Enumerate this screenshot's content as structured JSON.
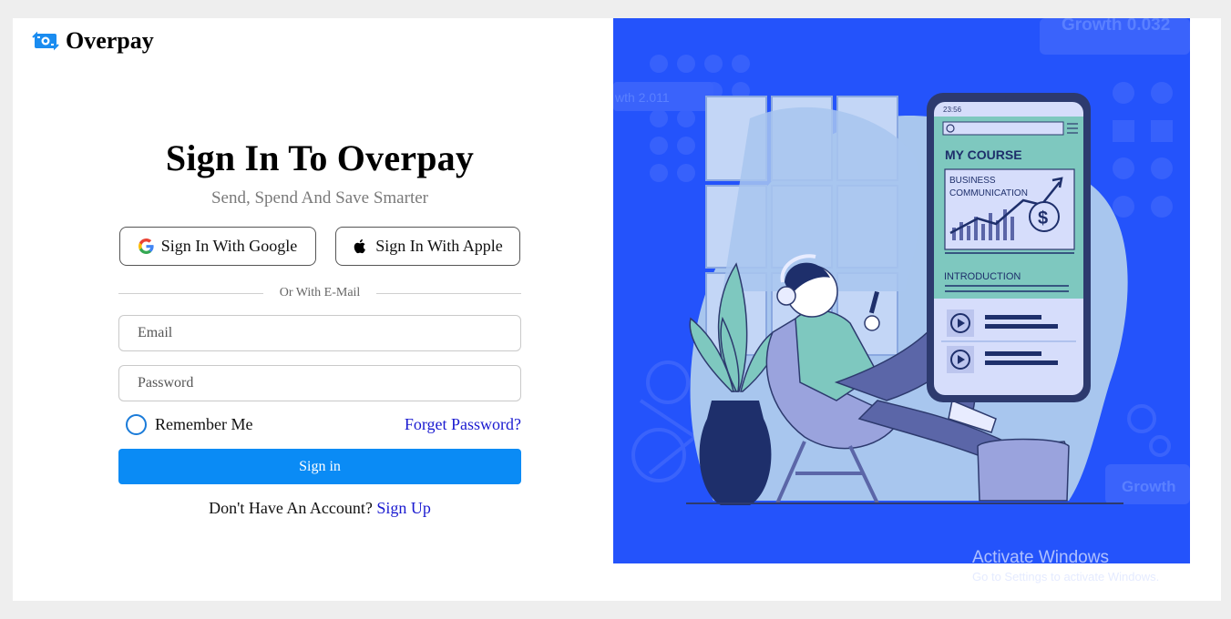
{
  "brand": {
    "name": "Overpay"
  },
  "form": {
    "title": "Sign In To Overpay",
    "subtitle": "Send, Spend And Save Smarter",
    "google_label": "Sign In With Google",
    "apple_label": "Sign In With Apple",
    "divider_text": "Or With E-Mail",
    "email_placeholder": "Email",
    "password_placeholder": "Password",
    "remember_label": "Remember Me",
    "forgot_label": "Forget Password?",
    "signin_label": "Sign in",
    "no_account_text": "Don't Have An Account?",
    "signup_label": "Sign Up"
  },
  "illustration": {
    "phone_time": "23:56",
    "course_title": "MY COURSE",
    "card_line1": "BUSINESS",
    "card_line2": "COMMUNICATION",
    "section_label": "INTRODUCTION",
    "bg_text1": "Growth 0.032",
    "bg_text2": "wth 2.011",
    "bg_text3": "Growth"
  },
  "watermark": {
    "line1": "Activate Windows",
    "line2": "Go to Settings to activate Windows."
  },
  "colors": {
    "accent": "#0a8bf5",
    "link": "#1a1ad0",
    "illustration_bg": "#2453fb",
    "panel_light": "#a8c6ee",
    "phone_teal": "#7ec8bf"
  }
}
